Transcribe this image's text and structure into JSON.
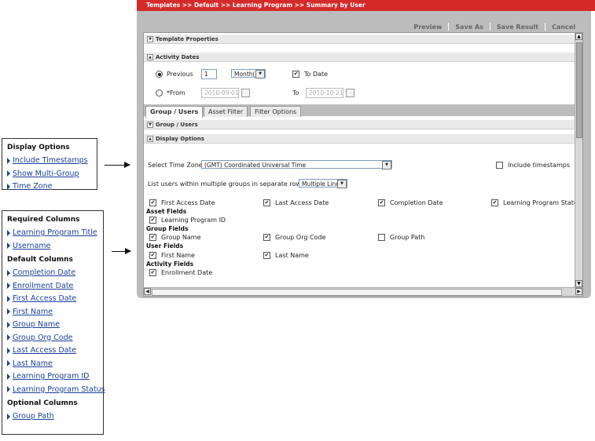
{
  "breadcrumb": "Templates >> Default >> Learning Program >> Summary by User",
  "actions": [
    "Preview",
    "Save As",
    "Save Result",
    "Cancel"
  ],
  "sections": {
    "template_properties": "Template Properties",
    "activity_dates": "Activity Dates",
    "group_users": "Group / Users",
    "display_options": "Display Options"
  },
  "activity_dates": {
    "previous_label": "Previous",
    "previous_value": "1",
    "period": "Month(s)",
    "to_date_label": "To Date",
    "from_label": "*From",
    "from_value": "2010-09-01",
    "to_label": "To",
    "to_value": "2010-10-21"
  },
  "tabs": [
    "Group / Users",
    "Asset Filter",
    "Filter Options"
  ],
  "display": {
    "tz_label": "Select Time Zone",
    "tz_value": "(GMT) Coordinated Universal Time",
    "include_timestamps": "Include timestamps",
    "multi_label": "List users within multiple groups in separate rows",
    "multi_value": "Multiple Lines"
  },
  "fields": {
    "row1": [
      "First Access Date",
      "Last Access Date",
      "Completion Date",
      "Learning Program Status"
    ],
    "asset_title": "Asset Fields",
    "asset": [
      "Learning Program ID"
    ],
    "group_title": "Group Fields",
    "group": [
      "Group Name",
      "Group Org Code",
      "Group Path"
    ],
    "user_title": "User Fields",
    "user": [
      "First Name",
      "Last Name"
    ],
    "activity_title": "Activity Fields",
    "activity": [
      "Enrollment Date"
    ]
  },
  "callout_display": {
    "title": "Display Options",
    "items": [
      "Include Timestamps",
      "Show Multi-Group",
      "Time Zone"
    ]
  },
  "callout_columns": {
    "required_title": "Required Columns",
    "required": [
      "Learning Program Title",
      "Username"
    ],
    "default_title": "Default Columns",
    "default": [
      "Completion Date",
      "Enrollment Date",
      "First Access Date",
      "First Name",
      "Group Name",
      "Group Org Code",
      "Last Access Date",
      "Last Name",
      "Learning Program ID",
      "Learning Program Status"
    ],
    "optional_title": "Optional Columns",
    "optional": [
      "Group Path"
    ]
  },
  "colors": {
    "brand_red": "#d42a2a",
    "link_blue": "#1b3f9a",
    "panel_gray": "#bcbcbc"
  }
}
